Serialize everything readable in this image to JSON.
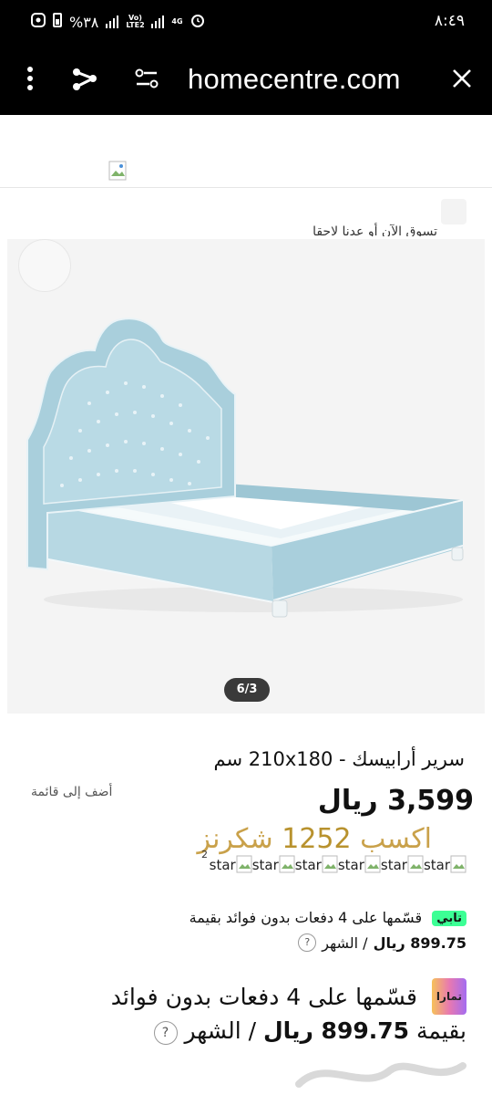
{
  "status_bar": {
    "battery": "%٣٨",
    "network_1": "Vo) LTE2",
    "network_2": "4G",
    "time": "٨:٤٩"
  },
  "toolbar": {
    "url": "homecentre.com"
  },
  "notice_strip": {
    "text": "تسوق الآن أو عدنا لاحقا"
  },
  "gallery": {
    "counter": "6/3"
  },
  "product": {
    "title": "سرير أرابيسك - 210x180 سم",
    "add_to_list": "أضف إلى قائمة",
    "price": "3,599 ريال",
    "points_prefix": "اكسب",
    "points_value": "1252",
    "points_suffix": "شكرنز",
    "star_labels": [
      "star",
      "star",
      "star",
      "star",
      "star",
      "star"
    ],
    "stars_superscript": "2"
  },
  "tabby": {
    "logo": "تابي",
    "line1": "قسّمها على 4 دفعات بدون فوائد بقيمة",
    "amount": "899.75 ريال",
    "per_month": "/ الشهر",
    "help": "?"
  },
  "tamara": {
    "logo": "تمارا",
    "line1": "قسّمها على 4 دفعات بدون فوائد",
    "prefix": "بقيمة",
    "amount": "899.75 ريال",
    "per_month": "/ الشهر",
    "help": "?"
  },
  "colors": {
    "bed": "#a9cfdc",
    "points_gold": "#c9a14a",
    "tabby_green": "#3cff95"
  }
}
